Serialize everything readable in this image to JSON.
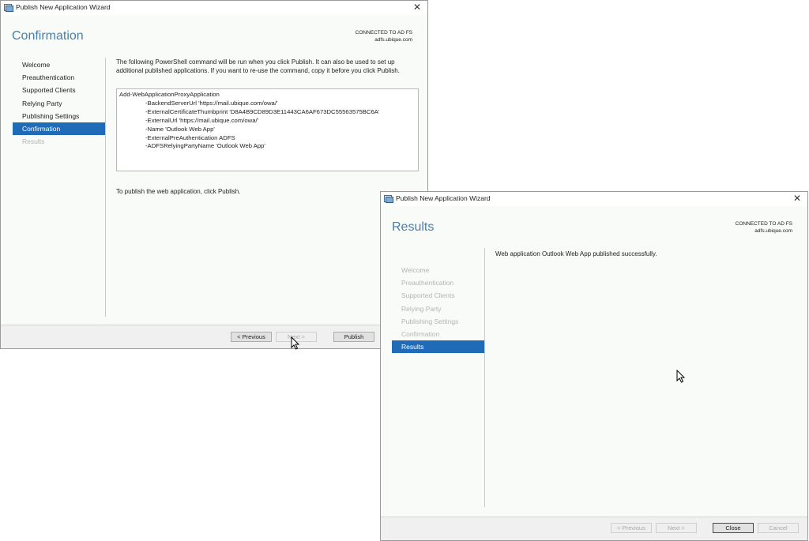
{
  "window1": {
    "title": "Publish New Application Wizard",
    "page_title": "Confirmation",
    "connection": {
      "status": "CONNECTED TO AD FS",
      "server": "adfs.ubique.com"
    },
    "nav": [
      {
        "label": "Welcome",
        "state": "normal"
      },
      {
        "label": "Preauthentication",
        "state": "normal"
      },
      {
        "label": "Supported Clients",
        "state": "normal"
      },
      {
        "label": "Relying Party",
        "state": "normal"
      },
      {
        "label": "Publishing Settings",
        "state": "normal"
      },
      {
        "label": "Confirmation",
        "state": "active"
      },
      {
        "label": "Results",
        "state": "dim"
      }
    ],
    "description": "The following PowerShell command will be run when you click Publish. It can also be used to set up additional published applications. If you want to re-use the command, copy it before you click Publish.",
    "command_lines": [
      "Add-WebApplicationProxyApplication",
      "-BackendServerUrl 'https://mail.ubique.com/owa/'",
      "-ExternalCertificateThumbprint 'D8A4B9CD89D3E11443CA6AF673DC55563575BC6A'",
      "-ExternalUrl 'https://mail.ubique.com/owa/'",
      "-Name 'Outlook Web App'",
      "-ExternalPreAuthentication ADFS",
      "-ADFSRelyingPartyName 'Outlook Web App'"
    ],
    "publish_note": "To publish the web application, click Publish.",
    "buttons": {
      "previous": "< Previous",
      "next": "Next >",
      "publish": "Publish"
    }
  },
  "window2": {
    "title": "Publish New Application Wizard",
    "page_title": "Results",
    "connection": {
      "status": "CONNECTED TO AD FS",
      "server": "adfs.ubique.com"
    },
    "nav": [
      {
        "label": "Welcome",
        "state": "dim"
      },
      {
        "label": "Preauthentication",
        "state": "dim"
      },
      {
        "label": "Supported Clients",
        "state": "dim"
      },
      {
        "label": "Relying Party",
        "state": "dim"
      },
      {
        "label": "Publishing Settings",
        "state": "dim"
      },
      {
        "label": "Confirmation",
        "state": "dim"
      },
      {
        "label": "Results",
        "state": "active"
      }
    ],
    "message": "Web application Outlook Web App published successfully.",
    "buttons": {
      "previous": "< Previous",
      "next": "Next >",
      "close": "Close",
      "cancel": "Cancel"
    }
  },
  "icons": {
    "app_icon": "wizard-app-icon",
    "close_icon": "close-icon",
    "cursor": "mouse-pointer-icon"
  },
  "colors": {
    "accent": "#1f6bb8",
    "title_text": "#4a7fa8",
    "dim_text": "#b4b4b4"
  }
}
